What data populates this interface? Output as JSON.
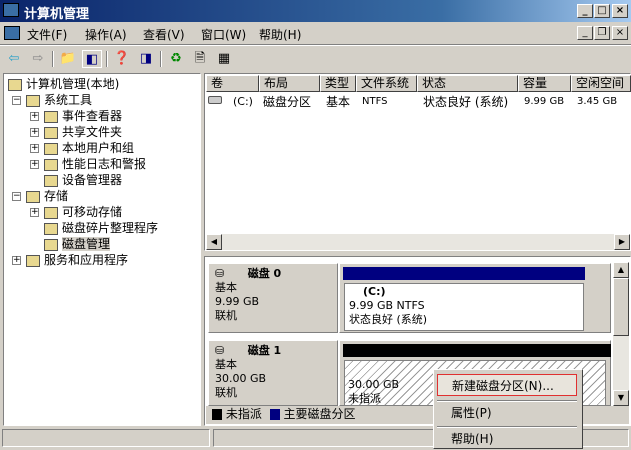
{
  "window": {
    "title": "计算机管理"
  },
  "menu": [
    "文件(F)",
    "操作(A)",
    "查看(V)",
    "窗口(W)",
    "帮助(H)"
  ],
  "tree": [
    {
      "label": "计算机管理(本地)",
      "level": 0
    },
    {
      "label": "系统工具",
      "level": 1
    },
    {
      "label": "事件查看器",
      "level": 2
    },
    {
      "label": "共享文件夹",
      "level": 2
    },
    {
      "label": "本地用户和组",
      "level": 2
    },
    {
      "label": "性能日志和警报",
      "level": 2
    },
    {
      "label": "设备管理器",
      "level": 2
    },
    {
      "label": "存储",
      "level": 1
    },
    {
      "label": "可移动存储",
      "level": 2
    },
    {
      "label": "磁盘碎片整理程序",
      "level": 2
    },
    {
      "label": "磁盘管理",
      "level": 2,
      "selected": true
    },
    {
      "label": "服务和应用程序",
      "level": 1
    }
  ],
  "volumes": {
    "headers": [
      "卷",
      "布局",
      "类型",
      "文件系统",
      "状态",
      "容量",
      "空闲空间"
    ],
    "rows": [
      {
        "volume": "(C:)",
        "layout": "磁盘分区",
        "type": "基本",
        "fs": "NTFS",
        "status": "状态良好 (系统)",
        "capacity": "9.99 GB",
        "free": "3.45 GB"
      }
    ]
  },
  "disks": [
    {
      "name": "磁盘 0",
      "type": "基本",
      "size": "9.99 GB",
      "state": "联机",
      "part_label": "(C:)",
      "part_size": "9.99 GB NTFS",
      "part_status": "状态良好 (系统)"
    },
    {
      "name": "磁盘 1",
      "type": "基本",
      "size": "30.00 GB",
      "state": "联机",
      "part_size": "30.00 GB",
      "part_status": "未指派"
    }
  ],
  "legend": {
    "unallocated": "未指派",
    "primary": "主要磁盘分区"
  },
  "context_menu": [
    "新建磁盘分区(N)...",
    "属性(P)",
    "帮助(H)"
  ],
  "colors": {
    "title": "#0a246a",
    "primary": "#000080",
    "unallocated": "#000000"
  }
}
